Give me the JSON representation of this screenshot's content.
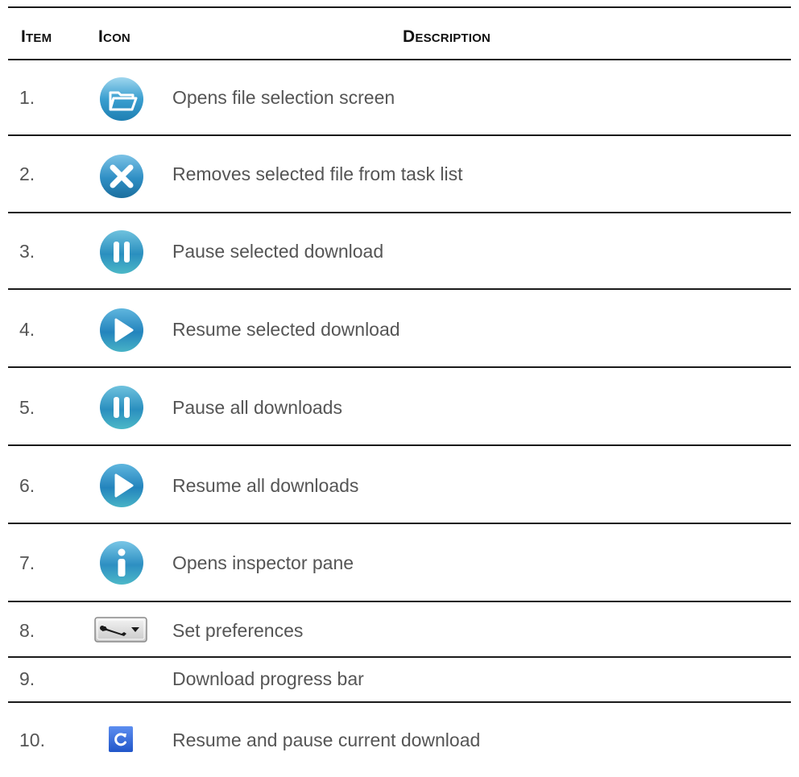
{
  "table": {
    "headers": {
      "item": "Item",
      "icon": "Icon",
      "description": "Description"
    },
    "rows": [
      {
        "item": "1.",
        "icon": "folder-icon",
        "description": "Opens file selection screen"
      },
      {
        "item": "2.",
        "icon": "remove-icon",
        "description": "Removes selected file from task list"
      },
      {
        "item": "3.",
        "icon": "pause-icon",
        "description": "Pause selected download"
      },
      {
        "item": "4.",
        "icon": "play-icon",
        "description": "Resume selected download"
      },
      {
        "item": "5.",
        "icon": "pause-all-icon",
        "description": "Pause all downloads"
      },
      {
        "item": "6.",
        "icon": "play-all-icon",
        "description": "Resume all downloads"
      },
      {
        "item": "7.",
        "icon": "info-icon",
        "description": "Opens inspector pane"
      },
      {
        "item": "8.",
        "icon": "wrench-dropdown-icon",
        "description": "Set preferences"
      },
      {
        "item": "9.",
        "icon": "",
        "description": "Download progress bar"
      },
      {
        "item": "10.",
        "icon": "refresh-icon",
        "description": "Resume and pause current download"
      }
    ]
  },
  "colors": {
    "rule": "#1a1a1a",
    "text": "#555555",
    "header": "#111111",
    "icon_blue": "#2f8fc0",
    "icon_teal": "#4fb7c9"
  }
}
